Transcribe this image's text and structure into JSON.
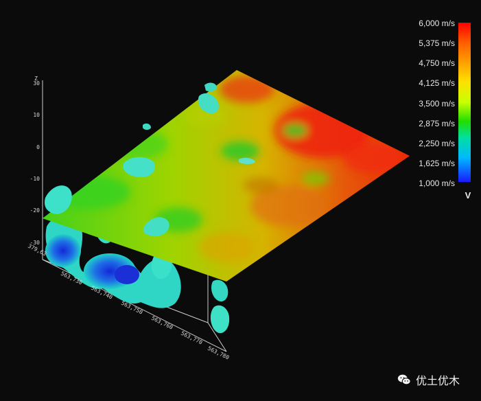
{
  "chart_data": {
    "type": "surface3d",
    "colorbar": {
      "title": "V",
      "unit": "m/s",
      "min": 1000,
      "max": 6000,
      "ticks": [
        "6,000 m/s",
        "5,375 m/s",
        "4,750 m/s",
        "4,125 m/s",
        "3,500 m/s",
        "2,875 m/s",
        "2,250 m/s",
        "1,625 m/s",
        "1,000 m/s"
      ],
      "colors": [
        "#ff0000",
        "#ff6a00",
        "#ffaa00",
        "#ffe600",
        "#d8ff00",
        "#22dd00",
        "#00e0b0",
        "#00c8ff",
        "#2020ff"
      ]
    },
    "z_axis": {
      "label": "Z",
      "ticks": [
        "30",
        "10",
        "0",
        "-10",
        "-20",
        "-30"
      ]
    },
    "x_axis": {
      "ticks": [
        "379,63",
        "563,730",
        "563,740",
        "563,750",
        "563,760",
        "563,770",
        "563,780"
      ]
    }
  },
  "watermark": {
    "text": "优土优木",
    "icon": "wechat-icon"
  }
}
